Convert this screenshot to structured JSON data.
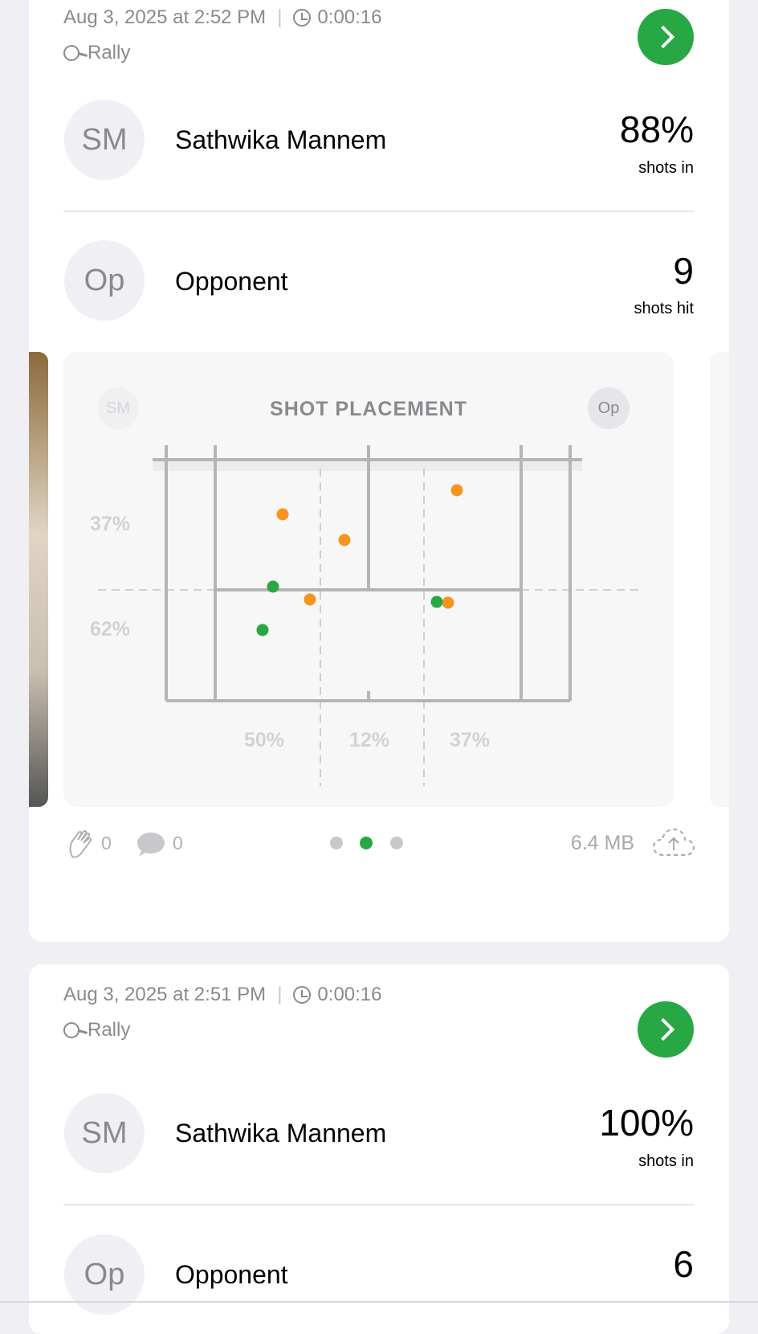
{
  "cards": [
    {
      "date": "Aug 3, 2025 at 2:52 PM",
      "duration": "0:00:16",
      "activity": "Rally",
      "player": {
        "initials": "SM",
        "name": "Sathwika Mannem",
        "stat_value": "88%",
        "stat_caption": "shots in"
      },
      "opponent": {
        "initials": "Op",
        "name": "Opponent",
        "stat_value": "9",
        "stat_caption": "shots hit"
      },
      "shot_placement": {
        "title": "SHOT PLACEMENT",
        "left_avatar": "SM",
        "right_avatar": "Op",
        "row_labels": [
          "37%",
          "62%"
        ],
        "col_labels": [
          "50%",
          "12%",
          "37%"
        ],
        "colors": {
          "opponent_shots": "#f7941d",
          "player_shots": "#28a745",
          "court_lines": "#b5b5b5"
        }
      },
      "footer": {
        "claps": "0",
        "comments": "0",
        "page_index": 1,
        "page_count": 3,
        "size": "6.4 MB"
      }
    },
    {
      "date": "Aug 3, 2025 at 2:51 PM",
      "duration": "0:00:16",
      "activity": "Rally",
      "player": {
        "initials": "SM",
        "name": "Sathwika Mannem",
        "stat_value": "100%",
        "stat_caption": "shots in"
      },
      "opponent": {
        "initials": "Op",
        "name": "Opponent",
        "stat_value": "6"
      }
    }
  ],
  "accent": "#28a745"
}
